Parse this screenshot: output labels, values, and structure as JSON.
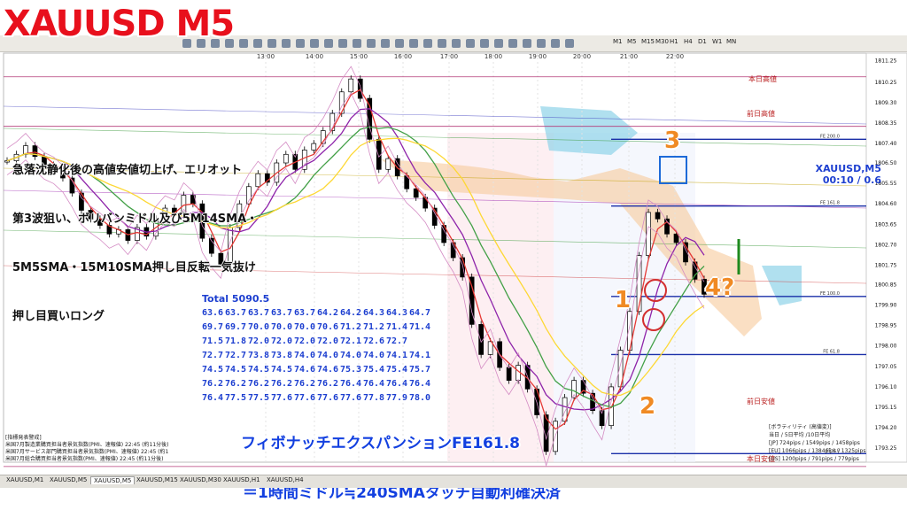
{
  "title": "XAUUSD M5",
  "annotations": {
    "line1": "急落沈静化後の高値安値切上げ、エリオット",
    "line2": "第3波狙い、ボリバンミドル及び5M14SMA・",
    "line3": "5M5SMA・15M10SMA押し目反転一気抜け",
    "line4": "押し目買いロング",
    "fe": "フィボナッチエクスパンションFE161.8",
    "exit": "＝1時間ミドル≒240SMAタッチ自動利確決済"
  },
  "waves": {
    "w1": "1",
    "w2": "2",
    "w3": "3",
    "w4": "4?"
  },
  "symbol_box": {
    "symbol": "XAUUSD,M5",
    "timer": "00:10 / 0.6"
  },
  "total": "Total 5090.5",
  "grid_values": [
    [
      "63.6",
      "63.7",
      "63.7",
      "63.7",
      "63.7",
      "64.2",
      "64.2",
      "64.3",
      "64.3",
      "64.7"
    ],
    [
      "69.7",
      "69.7",
      "70.0",
      "70.0",
      "70.0",
      "70.6",
      "71.2",
      "71.2",
      "71.4",
      "71.4"
    ],
    [
      "71.5",
      "71.8",
      "72.0",
      "72.0",
      "72.0",
      "72.0",
      "72.1",
      "72.6",
      "72.7"
    ],
    [
      "72.7",
      "72.7",
      "73.8",
      "73.8",
      "74.0",
      "74.0",
      "74.0",
      "74.0",
      "74.1",
      "74.1"
    ],
    [
      "74.5",
      "74.5",
      "74.5",
      "74.5",
      "74.6",
      "74.6",
      "75.3",
      "75.4",
      "75.4",
      "75.7"
    ],
    [
      "76.2",
      "76.2",
      "76.2",
      "76.2",
      "76.2",
      "76.2",
      "76.4",
      "76.4",
      "76.4",
      "76.4"
    ],
    [
      "76.4",
      "77.5",
      "77.5",
      "77.6",
      "77.6",
      "77.6",
      "77.6",
      "77.8",
      "77.9",
      "78.0"
    ]
  ],
  "level_labels": {
    "prev_high": "前日高値",
    "today_high": "本日高値",
    "prev_low": "前日安値",
    "today_low": "本日安値"
  },
  "toolbar_timeframes": [
    "M1",
    "M5",
    "M15",
    "M30",
    "H1",
    "H4",
    "D1",
    "W1",
    "MN"
  ],
  "tabs": [
    "XAUUSD,M1",
    "XAUUSD,M5",
    "XAUUSD,M5",
    "XAUUSD,M15",
    "XAUUSD,M30",
    "XAUUSD,H1",
    "XAUUSD,H4"
  ],
  "info_lines": [
    "[指標発表警戒]",
    "米国7月製造業購買担当者景気指数(PMI、速報値) 22:45 (約11分後)",
    "米国7月サービス部門購買担当者景気指数(PMI、速報値) 22:45 (約1",
    "米国7月総合購買担当者景気指数(PMI、速報値) 22:45 (約11分後)"
  ],
  "vol_lines": [
    "[ボラティリティ (高値変)]",
    "当日 / 5日平均 /10日平均",
    "[JP] 724pips / 1549pips / 1458pips",
    "[EU] 1066pips / 1384pips / 1325pips",
    "[US] 1200pips / 791pips / 779pips"
  ],
  "colors": {
    "accent_red": "#e8101c",
    "blue": "#1d3fd0",
    "orange": "#f08a24",
    "candle": "#000000"
  },
  "chart_data": {
    "type": "line",
    "title": "XAUUSD M5",
    "x_ticks": [
      "13:00",
      "14:00",
      "15:00",
      "16:00",
      "17:00",
      "18:00",
      "19:00",
      "20:00",
      "21:00",
      "22:00"
    ],
    "y_ticks": [
      1811.25,
      1810.25,
      1809.3,
      1808.35,
      1807.4,
      1806.5,
      1805.55,
      1804.6,
      1803.65,
      1802.7,
      1801.75,
      1800.85,
      1799.9,
      1798.95,
      1798.0,
      1797.05,
      1796.1,
      1795.15,
      1794.2,
      1793.25
    ],
    "ylim": [
      1792.6,
      1811.6
    ],
    "price": [
      1806.6,
      1806.9,
      1807.3,
      1806.8,
      1806.4,
      1806.2,
      1805.8,
      1805.1,
      1804.3,
      1803.9,
      1803.6,
      1803.2,
      1803.4,
      1802.9,
      1803.5,
      1803.1,
      1803.9,
      1804.4,
      1804.2,
      1805.0,
      1804.6,
      1803.0,
      1802.3,
      1801.8,
      1803.5,
      1804.6,
      1805.4,
      1806.0,
      1805.6,
      1806.5,
      1806.9,
      1806.2,
      1807.1,
      1807.4,
      1808.0,
      1808.8,
      1809.8,
      1810.4,
      1809.5,
      1807.6,
      1806.2,
      1806.7,
      1805.9,
      1805.3,
      1804.9,
      1804.4,
      1803.6,
      1802.8,
      1802.1,
      1801.2,
      1799.0,
      1797.6,
      1798.2,
      1797.0,
      1796.4,
      1797.1,
      1796.0,
      1794.8,
      1793.1,
      1794.5,
      1795.6,
      1796.4,
      1795.8,
      1795.0,
      1794.3,
      1796.1,
      1797.8,
      1799.6,
      1802.2,
      1804.2,
      1803.9,
      1803.2,
      1802.8,
      1801.9,
      1801.1,
      1800.4
    ],
    "levels": [
      {
        "name": "本日高値",
        "value": 1810.5
      },
      {
        "name": "前日高値",
        "value": 1808.2
      },
      {
        "name": "FE 200.0",
        "value": 1807.6
      },
      {
        "name": "FE 161.8",
        "value": 1804.5
      },
      {
        "name": "FE 100.0",
        "value": 1800.3
      },
      {
        "name": "FE 61.8",
        "value": 1797.6
      },
      {
        "name": "FE 0.0",
        "value": 1793.0
      },
      {
        "name": "前日安値",
        "value": 1792.4
      }
    ],
    "grid": false,
    "legend": "none"
  }
}
